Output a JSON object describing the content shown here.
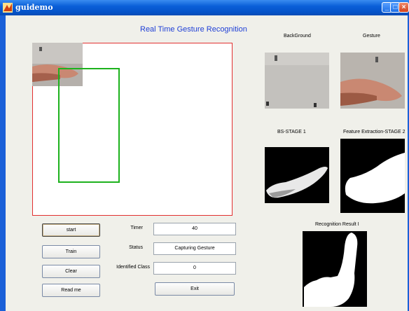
{
  "window": {
    "title": "guidemo"
  },
  "header": {
    "title": "Real Time Gesture Recognition"
  },
  "panels": {
    "background_label": "BackGround",
    "gesture_label": "Gesture",
    "bs_stage_label": "BS-STAGE 1",
    "feature_label": "Feature Extraction-STAGE 2",
    "result_label": "Recognition Result I"
  },
  "buttons": {
    "start": "start",
    "train": "Train",
    "clear": "Clear",
    "readme": "Read me",
    "exit": "Exit"
  },
  "fields": {
    "timer_label": "Timer",
    "timer_value": "40",
    "status_label": "Status",
    "status_value": "Capturing Gesture",
    "class_label": "Identified Class",
    "class_value": "0"
  },
  "colors": {
    "title_bar": "#0a5fd8",
    "header_text": "#1f3fd6",
    "axes_border": "#e23030",
    "roi_box": "#1db21d"
  },
  "icons": [
    "matlab-icon",
    "minimize-icon",
    "maximize-icon",
    "close-icon"
  ]
}
